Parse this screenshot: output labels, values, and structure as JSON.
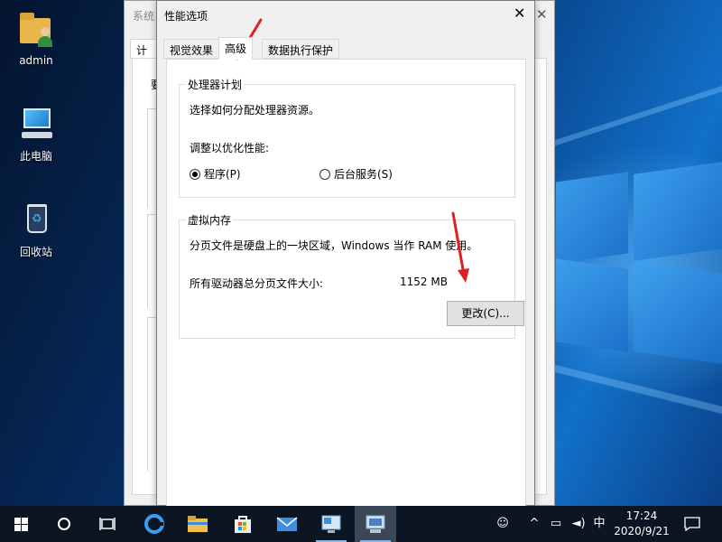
{
  "desktop": {
    "icons": [
      {
        "label": "admin",
        "icon": "user-folder-icon"
      },
      {
        "label": "此电脑",
        "icon": "this-pc-icon"
      },
      {
        "label": "回收站",
        "icon": "recycle-bin-icon"
      }
    ]
  },
  "back_window": {
    "title": "系统",
    "tab_fragment": "计算",
    "fragments": [
      "要"
    ]
  },
  "dialog": {
    "title": "性能选项",
    "close_glyph": "✕",
    "tabs": [
      {
        "label": "视觉效果",
        "active": false
      },
      {
        "label": "高级",
        "active": true
      },
      {
        "label": "数据执行保护",
        "active": false
      }
    ],
    "processor": {
      "legend": "处理器计划",
      "description": "选择如何分配处理器资源。",
      "adjust_label": "调整以优化性能:",
      "option_programs": "程序(P)",
      "option_background": "后台服务(S)",
      "selected": "programs"
    },
    "virtual_memory": {
      "legend": "虚拟内存",
      "description": "分页文件是硬盘上的一块区域，Windows 当作 RAM 使用。",
      "total_label": "所有驱动器总分页文件大小:",
      "total_value": "1152 MB",
      "change_button": "更改(C)..."
    }
  },
  "taskbar": {
    "tray": {
      "input_method": "中",
      "time": "17:24",
      "date": "2020/9/21"
    }
  },
  "colors": {
    "annotation_arrow": "#e02020",
    "taskbar": "#0c1622",
    "dialog_bg": "#f0f0f0"
  }
}
